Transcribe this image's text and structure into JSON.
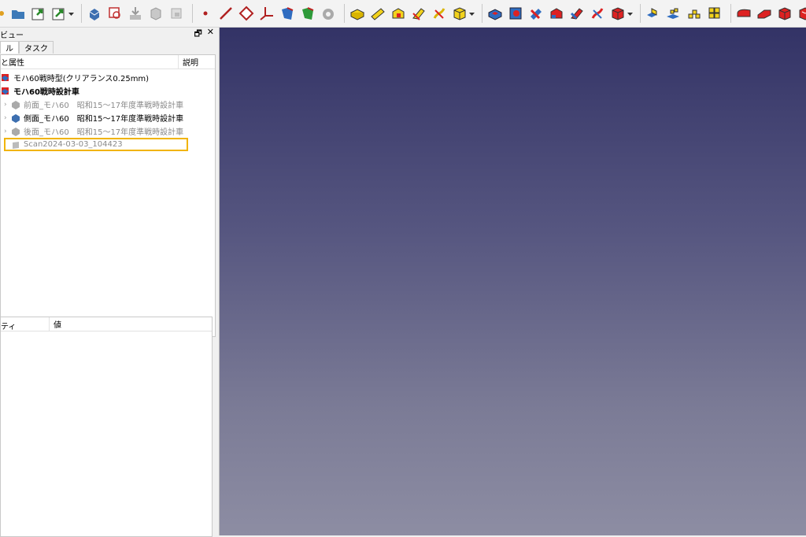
{
  "panel": {
    "title": "ビュー",
    "float_glyph": "🗗",
    "close_glyph": "✕"
  },
  "tabs": [
    {
      "label": "ル"
    },
    {
      "label": "タスク"
    }
  ],
  "tree": {
    "col_label": "と属性",
    "col_desc": "説明",
    "items": [
      {
        "label": "モハ60戦時型(クリアランス0.25mm)"
      },
      {
        "label": "モハ60戦時設計車"
      },
      {
        "label": "前面_モハ60　昭和15〜17年度準戦時設計車"
      },
      {
        "label": "側面_モハ60　昭和15〜17年度準戦時設計車"
      },
      {
        "label": "後面_モハ60　昭和15〜17年度準戦時設計車"
      },
      {
        "label": "Scan2024-03-03_104423"
      }
    ]
  },
  "properties": {
    "col_property": "ティ",
    "col_value": "値"
  },
  "colors": {
    "accent_select": "#f1b400",
    "viewport_top": "#333366",
    "viewport_bottom": "#8d8da3"
  },
  "toolbar_icons": [
    "part-icon",
    "folder-icon",
    "import-icon",
    "export-icon",
    "body-icon",
    "sketch-icon",
    "save-icon",
    "shape-icon",
    "lock-icon",
    "point-icon",
    "line-icon",
    "plane-icon",
    "axis-icon",
    "shape-binder-icon",
    "clone-icon",
    "sprocket-icon",
    "pad-icon",
    "revolve-icon",
    "loft-icon",
    "pipe-icon",
    "helix-icon",
    "additive-box-icon",
    "pocket-icon",
    "hole-icon",
    "groove-icon",
    "sub-loft-icon",
    "sub-pipe-icon",
    "sub-helix-icon",
    "sub-box-icon",
    "mirror-icon",
    "linear-pattern-icon",
    "polar-pattern-icon",
    "multi-transform-icon",
    "fillet-icon",
    "chamfer-icon",
    "draft-icon",
    "thickness-icon"
  ]
}
